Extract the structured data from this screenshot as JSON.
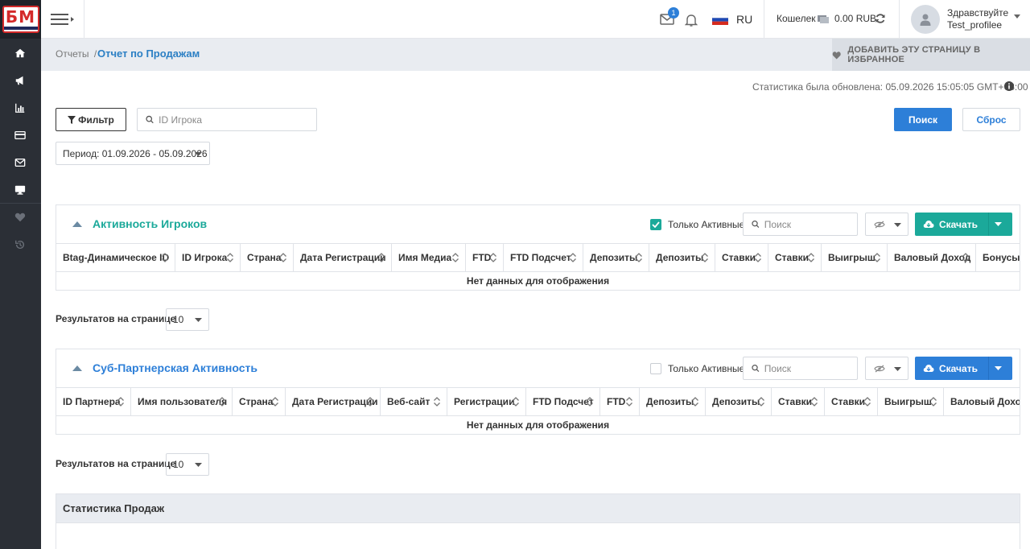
{
  "logo": {
    "text": "БМ",
    "subtitle": "PARTNERS"
  },
  "sidebar": {
    "icons": [
      "home-icon",
      "megaphone-icon",
      "bar-chart-icon",
      "credit-card-icon",
      "envelope-icon",
      "monitor-icon",
      "heart-icon",
      "history-icon"
    ]
  },
  "header": {
    "mail_badge": "1",
    "language": "RU",
    "wallet_label": "Кошелек",
    "wallet_amount": "0.00 RUB",
    "greeting": "Здравствуйте",
    "username": "Test_profilee"
  },
  "breadcrumb": {
    "root": "Отчеты",
    "separator": "/",
    "current": "Отчет по Продажам",
    "favorite_button": "ДОБАВИТЬ ЭТУ СТРАНИЦУ В ИЗБРАННОЕ"
  },
  "stats_updated": "Статистика была обновлена: 05.09.2026 15:05:05 GMT+03:00",
  "filters": {
    "filter_button": "Фильтр",
    "player_id_placeholder": "ID Игрока",
    "search_button": "Поиск",
    "reset_button": "Сброс",
    "period": "Период: 01.09.2026 - 05.09.2026"
  },
  "player_activity": {
    "title": "Активность Игроков",
    "only_active_label": "Только Активные",
    "only_active_checked": true,
    "search_placeholder": "Поиск",
    "download_button": "Скачать",
    "columns": [
      "Btag-Динамическое ID",
      "ID Игрока",
      "Страна",
      "Дата Регистрации",
      "Имя Медиа",
      "FTD",
      "FTD Подсчет",
      "Депозиты",
      "Депозиты",
      "Ставки",
      "Ставки",
      "Выигрыш",
      "Валовый Доход",
      "Бонусы/В"
    ],
    "empty_text": "Нет данных для отображения",
    "rows_per_page_label": "Результатов на странице",
    "rows_per_page": "10"
  },
  "sub_partner_activity": {
    "title": "Суб-Партнерская Активность",
    "only_active_label": "Только Активные",
    "only_active_checked": false,
    "search_placeholder": "Поиск",
    "download_button": "Скачать",
    "columns": [
      "ID Партнера",
      "Имя пользователя",
      "Страна",
      "Дата Регистрации",
      "Веб-сайт",
      "Регистрации",
      "FTD Подсчет",
      "FTD",
      "Депозиты",
      "Депозиты",
      "Ставки",
      "Ставки",
      "Выигрыш",
      "Валовый Доход"
    ],
    "empty_text": "Нет данных для отображения",
    "rows_per_page_label": "Результатов на странице",
    "rows_per_page": "10"
  },
  "sales_stats": {
    "title": "Статистика Продаж"
  },
  "colors": {
    "accent_blue": "#2d7fd8",
    "teal": "#1ba99a",
    "sidebar": "#2b2f36",
    "link": "#2b7fc4"
  }
}
